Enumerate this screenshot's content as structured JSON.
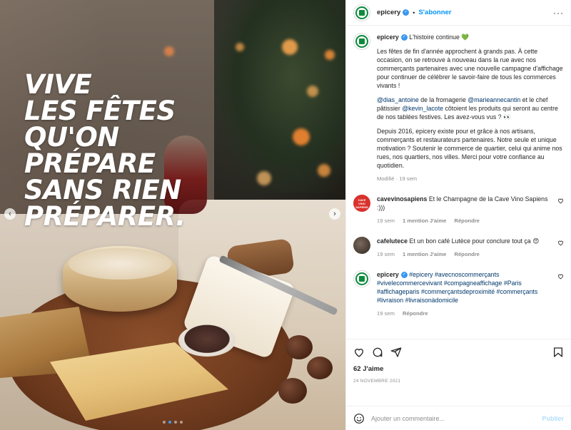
{
  "media": {
    "headline_lines": [
      "VIVE",
      "LES FÊTES",
      "QU'ON",
      "PRÉPARE",
      "SANS RIEN",
      "PRÉPARER."
    ],
    "prev_glyph": "‹",
    "next_glyph": "›",
    "carousel_dots": 4,
    "carousel_active": 1
  },
  "header": {
    "username": "epicery",
    "separator": "•",
    "follow_label": "S'abonner",
    "more_glyph": "···",
    "verified_glyph": "✓"
  },
  "caption": {
    "username": "epicery",
    "title": "L'histoire continue 💚",
    "p1": "Les fêtes de fin d'année approchent à grands pas. À cette occasion, on se retrouve à nouveau dans la rue avec nos commerçants partenaires avec une nouvelle campagne d'affichage pour continuer de célébrer le savoir-faire de tous les commerces vivants !",
    "p2_mention1": "@dias_antoine",
    "p2_text1": " de la fromagerie ",
    "p2_mention2": "@marieannecantin",
    "p2_text2": " et le chef pâtissier ",
    "p2_mention3": "@kevin_lacote",
    "p2_text3": " côtoient les produits qui seront au centre de nos tablées festives. Les avez-vous vus ? 👀",
    "p3": "Depuis 2016, epicery existe pour et grâce à nos artisans, commerçants et restaurateurs partenaires. Notre seule et unique motivation ? Soutenir le commerce de quartier, celui qui anime nos rues, nos quartiers, nos villes. Merci pour votre confiance au quotidien.",
    "meta": "Modifié · 19 sem"
  },
  "comments": [
    {
      "username": "cavevinosapiens",
      "text": "Et le Champagne de la Cave Vino Sapiens :)))",
      "time": "19 sem",
      "likes": "1 mention J'aime",
      "reply": "Répondre",
      "avatar_text": "CAVE VINO SAPIENS"
    },
    {
      "username": "cafelutece",
      "text": "Et un bon café Lutèce pour conclure tout ça 😍",
      "time": "19 sem",
      "likes": "1 mention J'aime",
      "reply": "Répondre"
    },
    {
      "username": "epicery",
      "text": "#epicery #avecnoscommerçants #vivelecommercevivant #compagneaffichage #Paris #affichageparis #commerçantsdeproximité #commerçants #livraison #livraisonàdomicile",
      "time": "19 sem",
      "reply": "Répondre"
    }
  ],
  "actions": {
    "likes": "62 J'aime",
    "date": "24 NOVEMBRE 2021"
  },
  "add_comment": {
    "placeholder": "Ajouter un commentaire...",
    "publish": "Publier"
  },
  "colors": {
    "brand_green": "#0b8a3b",
    "link_blue": "#0095f6",
    "verified_blue": "#3897f0",
    "carousel_active": "#3d9bf0"
  },
  "icons": [
    "heart-icon",
    "comment-icon",
    "share-icon",
    "bookmark-icon",
    "emoji-icon",
    "more-icon",
    "verified-icon",
    "chevron-left-icon",
    "chevron-right-icon"
  ]
}
